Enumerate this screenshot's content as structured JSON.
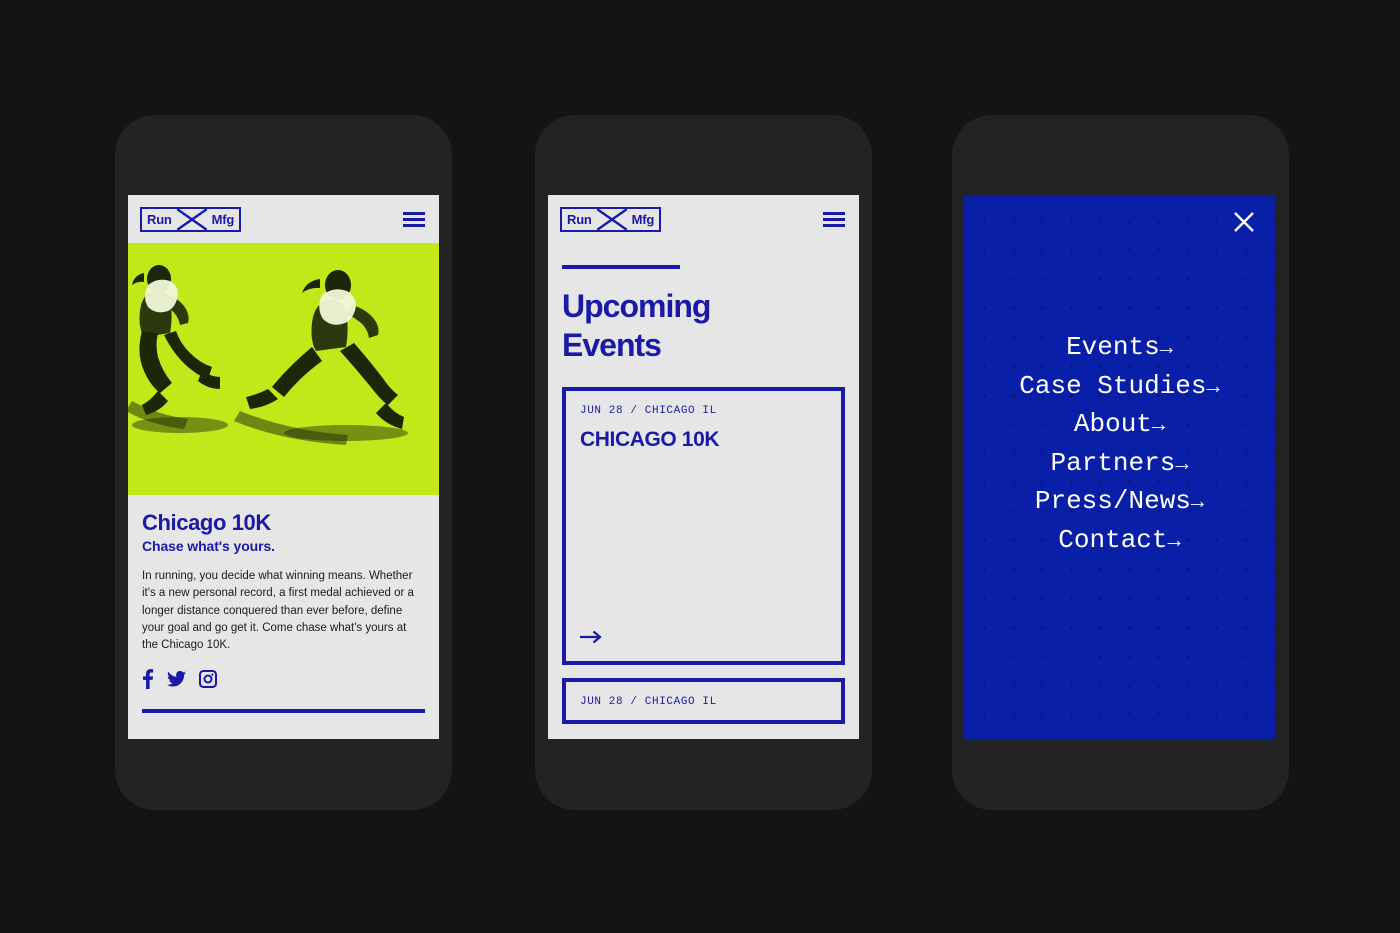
{
  "colors": {
    "page_background": "#141414",
    "device_frame": "#232323",
    "screen_background": "#e6e6e6",
    "brand_blue": "#1a1aa8",
    "menu_blue": "#0a1fa8",
    "accent_lime": "#c2e819",
    "body_text": "#1b1b1b",
    "menu_text": "#ffffff"
  },
  "brand": {
    "logo_left": "Run",
    "logo_right": "Mfg",
    "logo_divider_icon": "x-bowtie-icon"
  },
  "screen_one": {
    "menu_icon": "hamburger-icon",
    "hero_image_alt": "two-female-runners-duotone",
    "title": "Chicago 10K",
    "subtitle": "Chase what's yours.",
    "body": "In running, you decide what winning means. Whether it's a new personal record, a first medal achieved or a longer distance conquered than ever before, define your goal and go get it. Come chase what's yours at the Chicago 10K.",
    "socials": [
      {
        "name": "facebook-icon",
        "label": "Facebook"
      },
      {
        "name": "twitter-icon",
        "label": "Twitter"
      },
      {
        "name": "instagram-icon",
        "label": "Instagram"
      }
    ]
  },
  "screen_two": {
    "menu_icon": "hamburger-icon",
    "heading_line_1": "Upcoming",
    "heading_line_2": "Events",
    "cards": [
      {
        "meta": "JUN 28 / CHICAGO IL",
        "title": "CHICAGO 10K",
        "arrow": "→"
      },
      {
        "meta": "JUN 28 / CHICAGO IL",
        "title": "",
        "arrow": "→"
      }
    ]
  },
  "screen_three": {
    "close_icon": "close-icon",
    "menu_items": [
      {
        "label": "Events",
        "arrow": "→"
      },
      {
        "label": "Case Studies",
        "arrow": "→"
      },
      {
        "label": "About",
        "arrow": "→"
      },
      {
        "label": "Partners",
        "arrow": "→"
      },
      {
        "label": "Press/News",
        "arrow": "→"
      },
      {
        "label": "Contact",
        "arrow": "→"
      }
    ]
  }
}
